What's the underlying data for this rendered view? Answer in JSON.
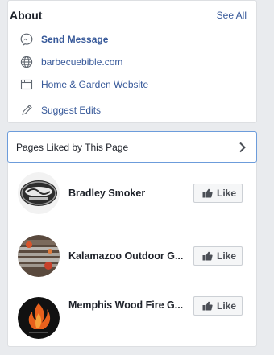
{
  "about": {
    "title": "About",
    "see_all": "See All",
    "items": [
      {
        "icon": "messenger-icon",
        "label": "Send Message"
      },
      {
        "icon": "globe-icon",
        "label": "barbecuebible.com"
      },
      {
        "icon": "window-icon",
        "label": "Home & Garden Website"
      },
      {
        "icon": "pencil-icon",
        "label": "Suggest Edits"
      }
    ]
  },
  "liked_pages": {
    "title": "Pages Liked by This Page",
    "like_label": "Like",
    "pages": [
      {
        "name": "Bradley Smoker"
      },
      {
        "name": "Kalamazoo Outdoor G..."
      },
      {
        "name": "Memphis Wood Fire G..."
      }
    ]
  },
  "colors": {
    "link": "#365899",
    "background": "#e9ebee",
    "header_border": "#6c9cdb"
  }
}
